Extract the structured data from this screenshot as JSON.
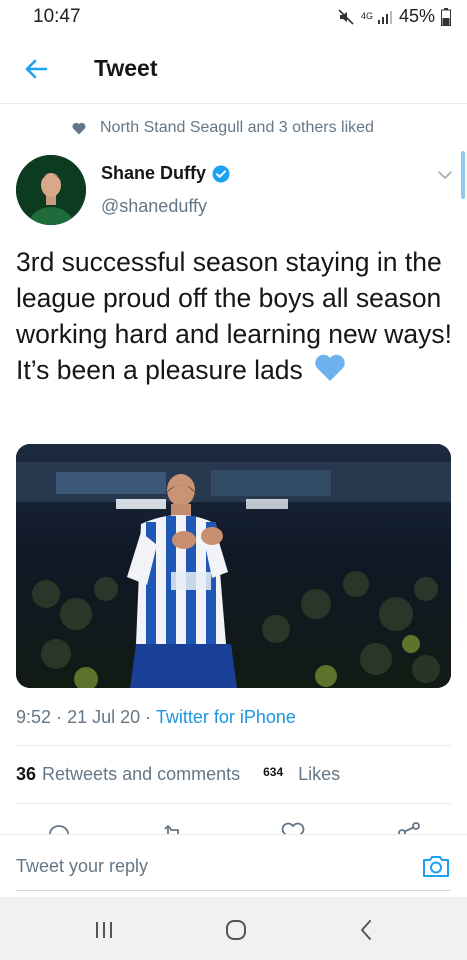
{
  "status_bar": {
    "time": "10:47",
    "network": "4G",
    "battery": "45%"
  },
  "header": {
    "title": "Tweet",
    "back_icon": "arrow-left-icon"
  },
  "social_context": {
    "text": "North Stand Seagull and 3 others liked",
    "icon": "heart-icon"
  },
  "author": {
    "name": "Shane Duffy",
    "handle": "@shaneduffy",
    "verified": true
  },
  "tweet": {
    "text": "3rd successful season staying in the league proud off the boys all season working hard and learning new ways! It’s been a pleasure lads",
    "emoji": "blue-heart",
    "media": "photo of player in blue and white striped kit applauding in stadium"
  },
  "meta": {
    "time": "9:52",
    "date": "21 Jul 20",
    "source": "Twitter for iPhone",
    "separator": "·"
  },
  "stats": {
    "retweets_count": "36",
    "retweets_label": "Retweets and comments",
    "likes_count": "634",
    "likes_label": "Likes"
  },
  "reply": {
    "placeholder": "Tweet your reply"
  },
  "colors": {
    "accent": "#1da1f2",
    "text": "#14171a",
    "secondary": "#657786",
    "heart": "#6cb3ee"
  }
}
